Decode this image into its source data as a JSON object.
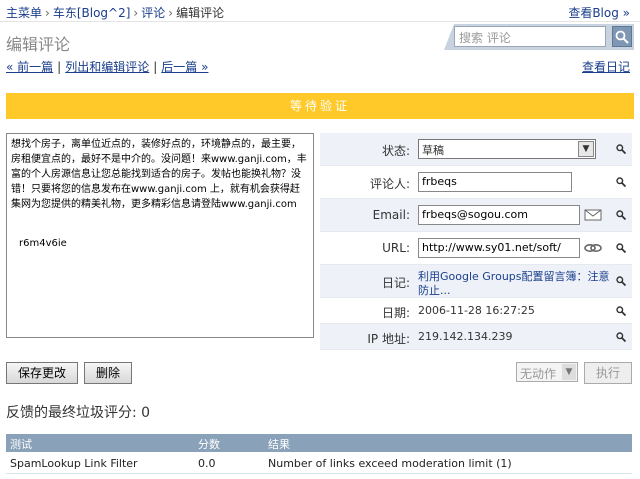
{
  "breadcrumb": {
    "items": [
      "主菜单",
      "车东[Blog^2]",
      "评论"
    ],
    "current": "编辑评论",
    "sep": "›"
  },
  "header": {
    "view_blog": "查看Blog »",
    "page_title": "编辑评论",
    "search_placeholder": "搜索 评论"
  },
  "nav": {
    "prev": "« 前一篇",
    "list": "列出和编辑评论",
    "next": "后一篇 »",
    "view_diary": "查看日记"
  },
  "status_banner": "等待验证",
  "comment": {
    "body": "想找个房子，离单位近点的，装修好点的，环境静点的，最主要，房租便宜点的，最好不是中介的。没问题！来www.ganji.com，丰富的个人房源信息让您总能找到适合的房子。发帖也能换礼物？没错！只要将您的信息发布在www.ganji.com 上，就有机会获得赶集网为您提供的精美礼物，更多精彩信息请登陆www.ganji.com",
    "signature": "r6m4v6ie"
  },
  "fields": {
    "status_label": "状态:",
    "status_value": "草稿",
    "author_label": "评论人:",
    "author_value": "frbeqs",
    "email_label": "Email:",
    "email_value": "frbeqs@sogou.com",
    "url_label": "URL:",
    "url_value": "http://www.sy01.net/soft/",
    "diary_label": "日记:",
    "diary_value": "利用Google Groups配置留言簿：注意防止...",
    "date_label": "日期:",
    "date_value": "2006-11-28 16:27:25",
    "ip_label": "IP 地址:",
    "ip_value": "219.142.134.239"
  },
  "actions": {
    "save": "保存更改",
    "delete": "删除",
    "action_select": "无动作",
    "execute": "执行"
  },
  "spam": {
    "score_text": "反馈的最终垃圾评分: 0",
    "columns": [
      "测试",
      "分数",
      "结果"
    ],
    "rows": [
      [
        "SpamLookup Link Filter",
        "0.0",
        "Number of links exceed moderation limit (1)"
      ]
    ]
  },
  "colors": {
    "status_banner": "#ffc929",
    "table_header": "#8aa2b9",
    "link": "#1a3e8c"
  }
}
